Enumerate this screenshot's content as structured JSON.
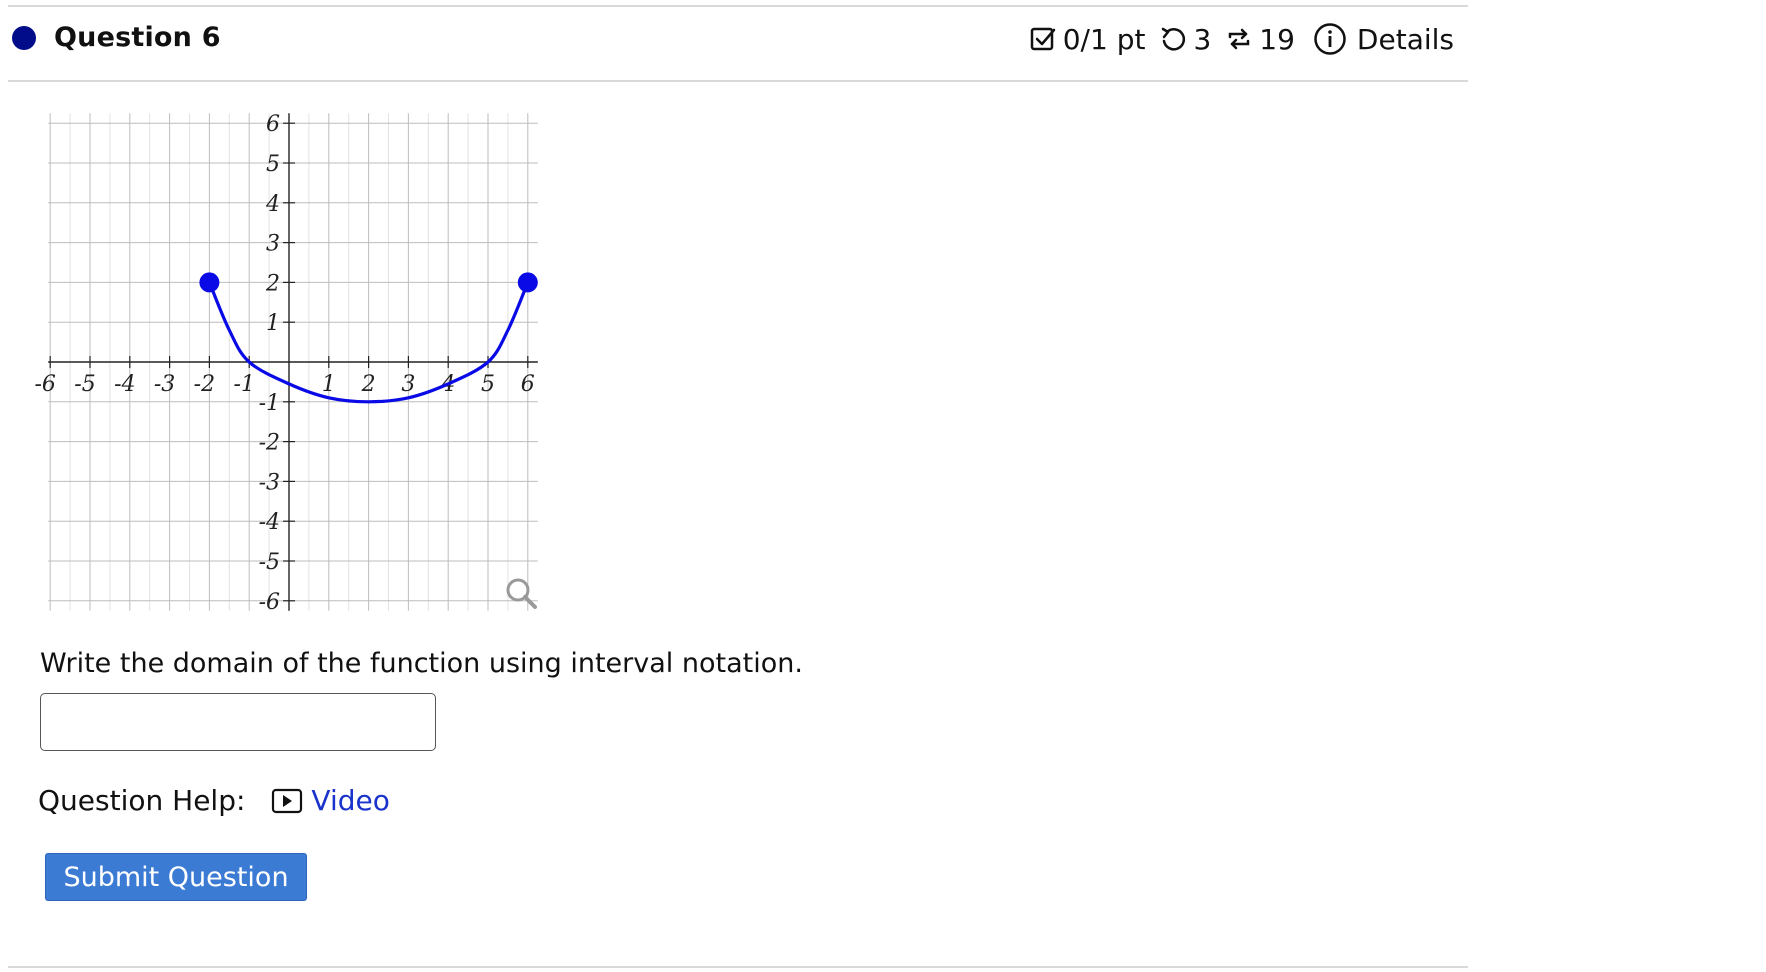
{
  "question": {
    "title": "Question 6",
    "points": "0/1 pt",
    "retries": "3",
    "submissions": "19",
    "details_label": "Details"
  },
  "chart_data": {
    "type": "line",
    "xlim": [
      -6,
      6
    ],
    "ylim": [
      -6,
      6
    ],
    "x_ticks": [
      "-6",
      "-5",
      "-4",
      "-3",
      "-2",
      "-1",
      "1",
      "2",
      "3",
      "4",
      "5",
      "6"
    ],
    "y_ticks": [
      "6",
      "5",
      "4",
      "3",
      "2",
      "1",
      "-1",
      "-2",
      "-3",
      "-4",
      "-5",
      "-6"
    ],
    "grid": true,
    "series": [
      {
        "points": [
          [
            -2,
            2
          ],
          [
            -1.5,
            0.8
          ],
          [
            -1,
            0
          ],
          [
            0,
            -0.55
          ],
          [
            1,
            -0.9
          ],
          [
            2,
            -1
          ],
          [
            3,
            -0.9
          ],
          [
            4,
            -0.55
          ],
          [
            5,
            0
          ],
          [
            5.5,
            0.8
          ],
          [
            6,
            2
          ]
        ],
        "endpoints": [
          [
            -2,
            2
          ],
          [
            6,
            2
          ]
        ],
        "color": "#0a0ae6"
      }
    ],
    "zoom_icon": "magnifier-icon"
  },
  "prompt": "Write the domain of the function using interval notation.",
  "answer": {
    "value": ""
  },
  "help": {
    "label": "Question Help:",
    "video_label": "Video"
  },
  "submit_label": "Submit Question"
}
